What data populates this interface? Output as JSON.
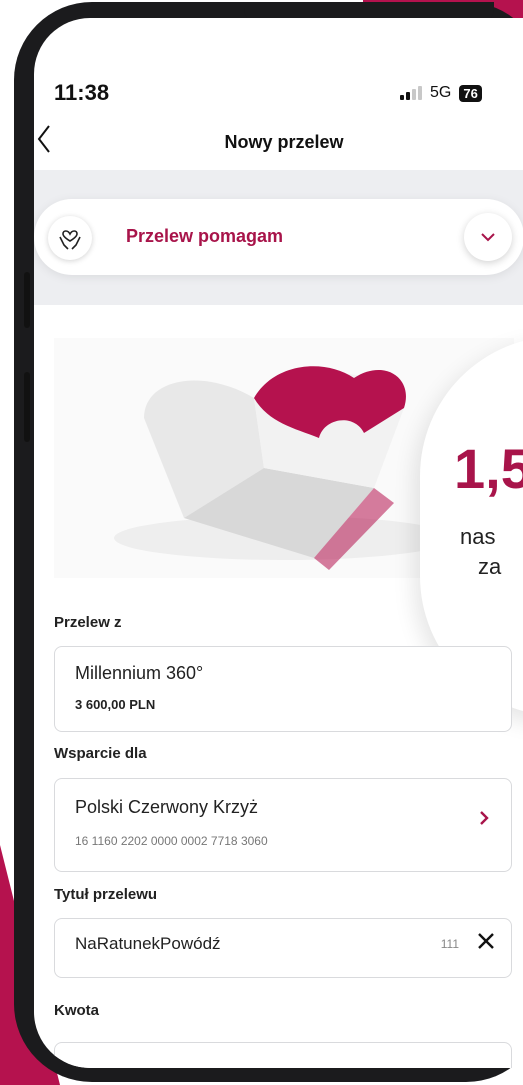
{
  "status_bar": {
    "time": "11:38",
    "network": "5G",
    "battery": "76"
  },
  "nav": {
    "back_icon": "chevron-left-icon",
    "title": "Nowy przelew"
  },
  "transfer_type": {
    "label": "Przelew pomagam",
    "icon": "heart-hands-icon",
    "chevron_icon": "chevron-down-icon"
  },
  "promo": {
    "big_text": "1,5",
    "line1": "nas",
    "line2": "za"
  },
  "from_account": {
    "label": "Przelew z",
    "name": "Millennium 360°",
    "balance": "3 600,00 PLN"
  },
  "recipient": {
    "label": "Wsparcie dla",
    "name": "Polski Czerwony Krzyż",
    "account": "16 1160 2202 0000 0002 7718 3060"
  },
  "title_field": {
    "label": "Tytuł przelewu",
    "value": "NaRatunekPowódź",
    "char_count": "111"
  },
  "amount": {
    "label": "Kwota"
  },
  "colors": {
    "accent": "#a8144a",
    "band": "#edeef1"
  }
}
